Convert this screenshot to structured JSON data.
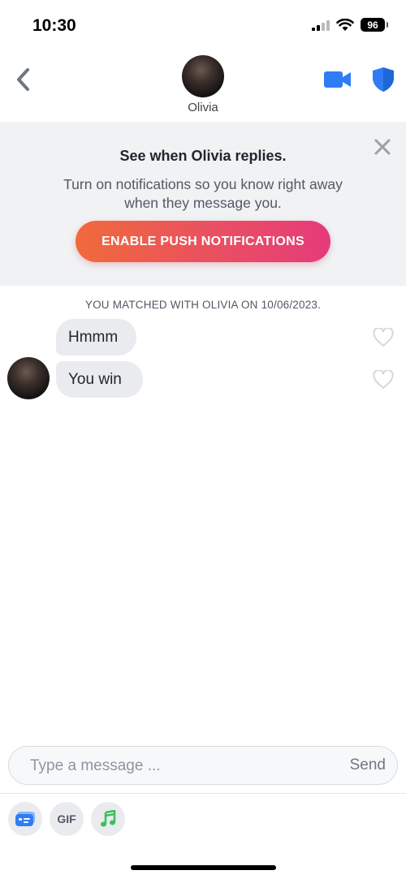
{
  "status_bar": {
    "time": "10:30",
    "battery": "96"
  },
  "header": {
    "name": "Olivia"
  },
  "banner": {
    "title": "See when Olivia replies.",
    "text": "Turn on notifications so you know right away when they message you.",
    "button_label": "ENABLE PUSH NOTIFICATIONS"
  },
  "chat": {
    "match_text": "YOU MATCHED WITH OLIVIA ON 10/06/2023.",
    "messages": [
      {
        "text": "Hmmm"
      },
      {
        "text": "You win"
      }
    ]
  },
  "composer": {
    "placeholder": "Type a message ...",
    "send_label": "Send"
  },
  "tools": {
    "gif_label": "GIF"
  },
  "colors": {
    "accent_blue": "#2f7cf6",
    "gradient_start": "#f06a3a",
    "gradient_end": "#e53b7a",
    "music_green": "#3fbf5a"
  }
}
